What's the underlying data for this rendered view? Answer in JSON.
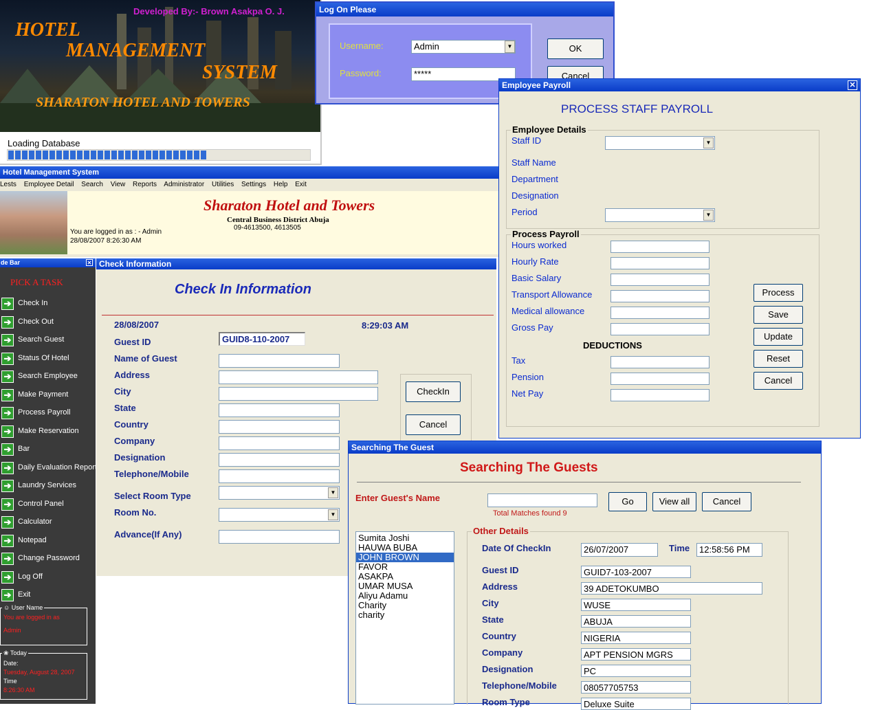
{
  "splash": {
    "developer": "Developed By:- Brown Asakpa O. J.",
    "title_line1": "HOTEL",
    "title_line2": "MANAGEMENT",
    "title_line3": "SYSTEM",
    "hotel_name": "SHARATON HOTEL AND TOWERS",
    "loading_text": "Loading Database",
    "progress": 0.66
  },
  "logon": {
    "title": "Log On Please",
    "username_label": "Username:",
    "username_value": "Admin",
    "password_label": "Password:",
    "password_value": "*****",
    "ok_label": "OK",
    "cancel_label": "Cancel"
  },
  "main_window": {
    "title": "Hotel Management System",
    "menu": [
      "Lests",
      "Employee Detail",
      "Search",
      "View",
      "Reports",
      "Administrator",
      "Utilities",
      "Settings",
      "Help",
      "Exit"
    ],
    "banner_title": "Sharaton Hotel and Towers",
    "banner_address": "Central Business District Abuja",
    "banner_phone": "09-4613500, 4613505",
    "logged_in": "You are logged in as : - Admin",
    "datetime": "28/08/2007 8:26:30 AM"
  },
  "sidebar": {
    "title": "de Bar",
    "heading": "PICK A TASK",
    "items": [
      {
        "label": "Check In"
      },
      {
        "label": "Check Out"
      },
      {
        "label": "Search Guest"
      },
      {
        "label": "Status Of Hotel"
      },
      {
        "label": "Search Employee"
      },
      {
        "label": "Make Payment"
      },
      {
        "label": "Process Payroll"
      },
      {
        "label": "Make Reservation"
      },
      {
        "label": "Bar"
      },
      {
        "label": "Daily Evaluation Report"
      },
      {
        "label": "Laundry Services"
      },
      {
        "label": "Control Panel"
      },
      {
        "label": "Calculator"
      },
      {
        "label": "Notepad"
      },
      {
        "label": "Change Password"
      },
      {
        "label": "Log Off"
      },
      {
        "label": "Exit"
      }
    ],
    "user_group_title": "User Name",
    "user_line1": "You are logged in as",
    "user_line2": "Admin",
    "today_title": "Today",
    "date_label": "Date:",
    "date_value": "Tuesday, August 28, 2007",
    "time_label": "Time",
    "time_value": "8:26:30 AM"
  },
  "checkin": {
    "title": "Check Information",
    "heading": "Check In Information",
    "date": "28/08/2007",
    "time": "8:29:03 AM",
    "guest_id_label": "Guest ID",
    "guest_id_value": "GUID8-110-2007",
    "fields": [
      "Name of Guest",
      "Address",
      "City",
      "State",
      "Country",
      "Company",
      "Designation",
      "Telephone/Mobile"
    ],
    "room_type_label": "Select Room Type",
    "room_no_label": "Room No.",
    "advance_label": "Advance(If Any)",
    "checkin_button": "CheckIn",
    "cancel_button": "Cancel"
  },
  "payroll": {
    "title": "Employee Payroll",
    "heading": "PROCESS STAFF PAYROLL",
    "employee_group": "Employee Details",
    "staff_id_label": "Staff ID",
    "staff_name_label": "Staff Name",
    "department_label": "Department",
    "designation_label": "Designation",
    "period_label": "Period",
    "process_group": "Process Payroll",
    "pay_fields": [
      "Hours worked",
      "Hourly Rate",
      "Basic Salary",
      "Transport Allowance",
      "Medical allowance",
      "Gross Pay"
    ],
    "deductions_label": "DEDUCTIONS",
    "deduction_fields": [
      "Tax",
      "Pension",
      "Net Pay"
    ],
    "buttons": [
      "Process",
      "Save",
      "Update",
      "Reset",
      "Cancel"
    ]
  },
  "search": {
    "title": "Searching The Guest",
    "heading": "Searching The Guests",
    "enter_label": "Enter Guest's Name",
    "go_button": "Go",
    "view_all_button": "View all",
    "cancel_button": "Cancel",
    "matches": "Total Matches found 9",
    "guests": [
      "Sumita Joshi",
      "HAUWA BUBA",
      "JOHN BROWN",
      "FAVOR",
      "ASAKPA",
      "UMAR MUSA",
      "Aliyu Adamu",
      "Charity",
      "charity"
    ],
    "selected_guest": "JOHN BROWN",
    "details_group": "Other Details",
    "date_checkin_label": "Date Of CheckIn",
    "date_checkin_value": "26/07/2007",
    "time_label": "Time",
    "time_value": "12:58:56 PM",
    "details": [
      {
        "label": "Guest ID",
        "value": "GUID7-103-2007"
      },
      {
        "label": "Address",
        "value": "39 ADETOKUMBO"
      },
      {
        "label": "City",
        "value": "WUSE"
      },
      {
        "label": "State",
        "value": "ABUJA"
      },
      {
        "label": "Country",
        "value": "NIGERIA"
      },
      {
        "label": "Company",
        "value": "APT PENSION MGRS"
      },
      {
        "label": "Designation",
        "value": "PC"
      },
      {
        "label": "Telephone/Mobile",
        "value": "08057705753"
      },
      {
        "label": "Room Type",
        "value": "Deluxe Suite"
      }
    ]
  }
}
